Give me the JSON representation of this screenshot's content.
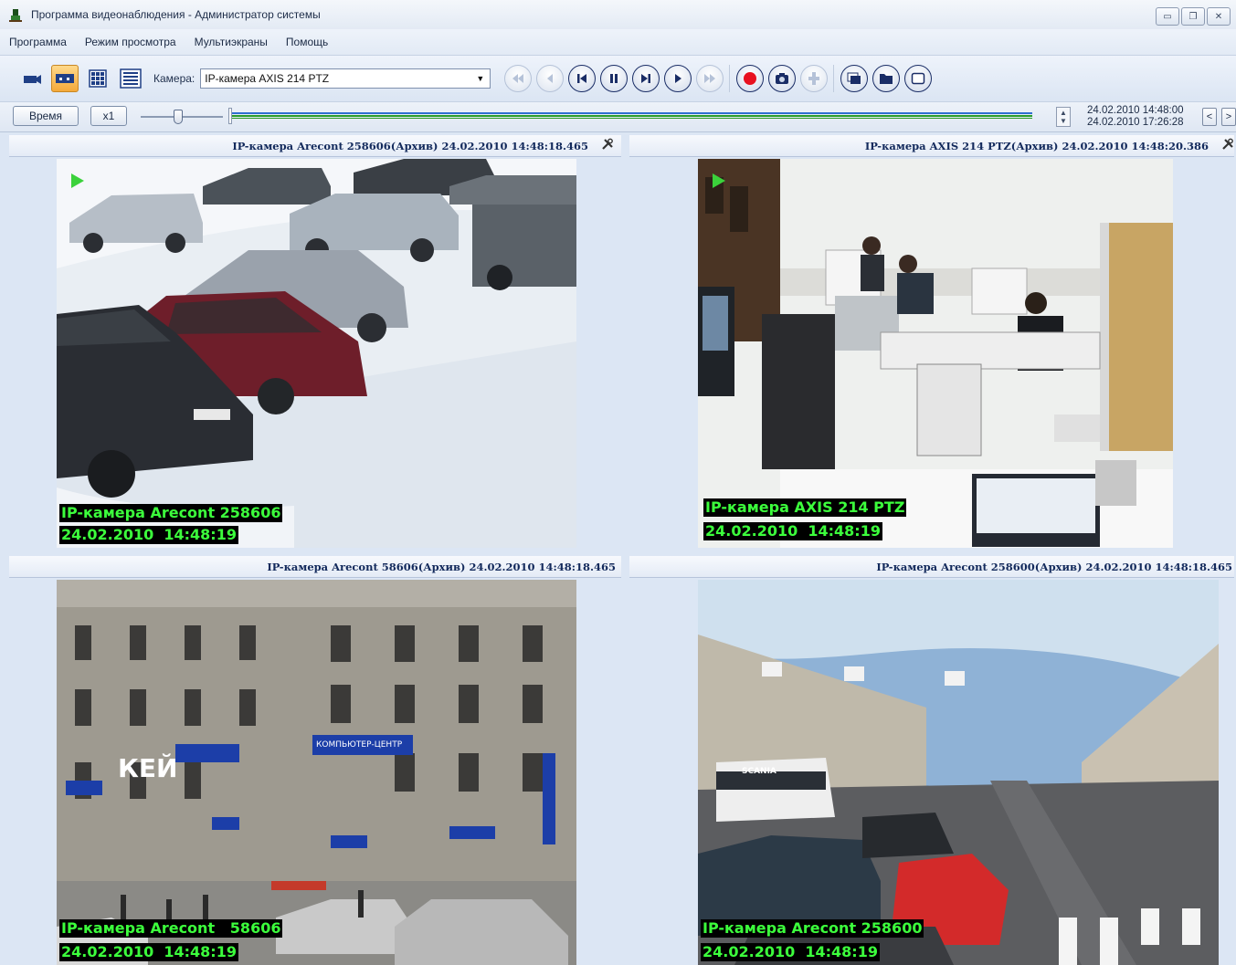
{
  "window": {
    "title": "Программа видеонаблюдения - Администратор системы"
  },
  "menu": {
    "items": [
      "Программа",
      "Режим просмотра",
      "Мультиэкраны",
      "Помощь"
    ]
  },
  "toolbar": {
    "camera_label": "Камера:",
    "camera_selected": "IP-камера AXIS 214 PTZ",
    "icons": [
      "camera-icon",
      "dual-view-icon",
      "grid-view-icon",
      "list-view-icon",
      "rewind-fast-icon",
      "step-back-icon",
      "skip-start-icon",
      "pause-icon",
      "skip-end-icon",
      "play-icon",
      "fast-forward-icon",
      "record-icon",
      "snapshot-icon",
      "ptz-icon",
      "window-layers-icon",
      "folder-icon",
      "fullscreen-icon"
    ]
  },
  "timebar": {
    "time_button": "Время",
    "speed_button": "x1",
    "range_start": "24.02.2010 14:48:00",
    "range_end": "24.02.2010 17:26:28",
    "prev": "<",
    "next": ">",
    "spin_up": "▲",
    "spin_down": "▼"
  },
  "panels": [
    {
      "header": "IP-камера Arecont 258606(Архив) 24.02.2010 14:48:18.465",
      "osd_name": "IP-камера Arecont 258606",
      "osd_time": "24.02.2010  14:48:19",
      "scene": "snowy-parking-lot",
      "playing": true
    },
    {
      "header": "IP-камера AXIS 214 PTZ(Архив) 24.02.2010 14:48:20.386",
      "osd_name": "IP-камера AXIS 214 PTZ",
      "osd_time": "24.02.2010  14:48:19",
      "scene": "office-room",
      "playing": true
    },
    {
      "header": "IP-камера Arecont   58606(Архив) 24.02.2010 14:48:18.465",
      "osd_name": "IP-камера Arecont   58606",
      "osd_time": "24.02.2010  14:48:19",
      "scene": "city-building-corner",
      "playing": false
    },
    {
      "header": "IP-камера Arecont 258600(Архив) 24.02.2010 14:48:18.465",
      "osd_name": "IP-камера Arecont 258600",
      "osd_time": "24.02.2010  14:48:19",
      "scene": "city-street-traffic",
      "playing": false
    }
  ],
  "signs": {
    "shop_name": "КЕЙ",
    "shop_type": "КОМПЬЮТЕР-ЦЕНТР",
    "bus": "SCANIA"
  },
  "colors": {
    "accent": "#f4a93a",
    "osd_text": "#3cff3c",
    "play_marker": "#3bd23b",
    "record": "#e8101e"
  }
}
